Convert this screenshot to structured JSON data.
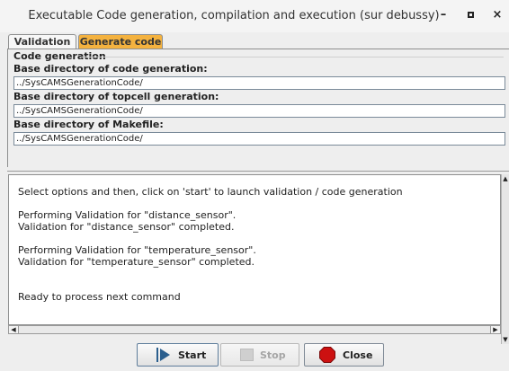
{
  "window": {
    "title": "Executable Code generation, compilation and execution (sur debussy)",
    "minimize_glyph": "–",
    "maximize_glyph": "▫",
    "close_glyph": "×"
  },
  "tabs": [
    {
      "label": "Validation",
      "active": false
    },
    {
      "label": "Generate code",
      "active": true
    }
  ],
  "code_generation": {
    "group_title": "Code generation",
    "fields": [
      {
        "label": "Base directory of code generation:",
        "value": "../SysCAMSGenerationCode/"
      },
      {
        "label": "Base directory of topcell generation:",
        "value": "../SysCAMSGenerationCode/"
      },
      {
        "label": "Base directory of Makefile:",
        "value": "../SysCAMSGenerationCode/"
      }
    ]
  },
  "console": {
    "lines": [
      "Select options and then, click on 'start' to launch validation / code generation",
      "",
      "Performing Validation for \"distance_sensor\".",
      "Validation for \"distance_sensor\" completed.",
      "",
      "Performing Validation for \"temperature_sensor\".",
      "Validation for \"temperature_sensor\" completed.",
      "",
      "",
      "Ready to process next command"
    ]
  },
  "buttons": {
    "start": "Start",
    "stop": "Stop",
    "close": "Close"
  },
  "colors": {
    "active_tab": "#f4b23f",
    "start_icon": "#2b5f8e",
    "close_icon": "#cc1111"
  },
  "icons": {
    "start": "play-icon",
    "stop": "stop-icon",
    "close": "stop-sign-icon"
  }
}
